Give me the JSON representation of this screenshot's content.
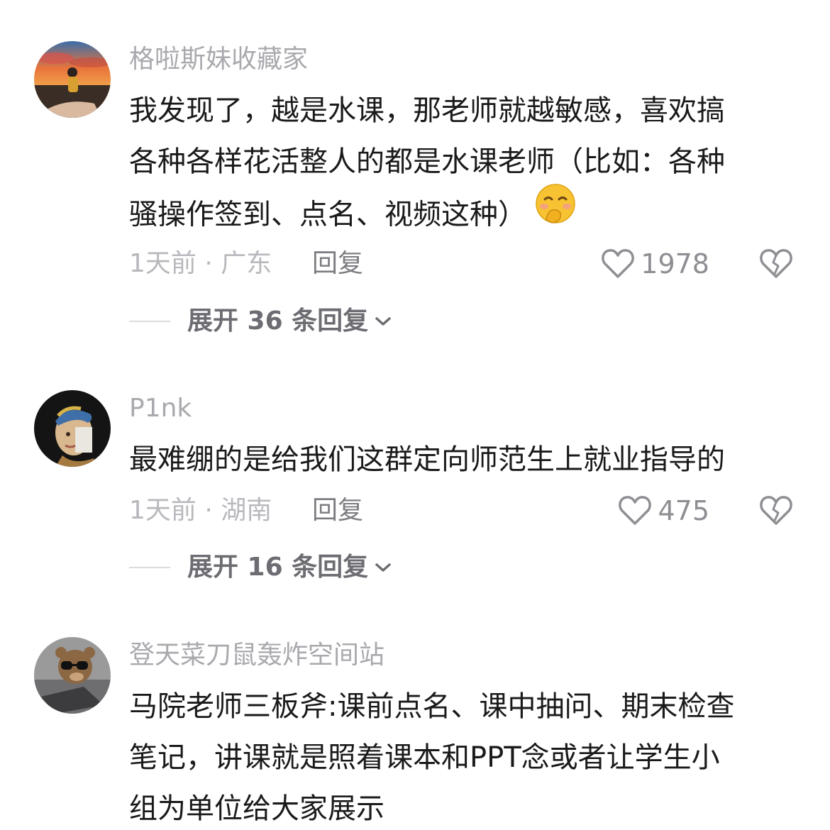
{
  "comments": [
    {
      "username": "格啦斯妹收藏家",
      "lines": [
        "我发现了，越是水课，那老师就越敏感，喜欢搞",
        "各种各样花活整人的都是水课老师（比如：各种",
        "骚操作签到、点名、视频这种）"
      ],
      "emoji": "shy-smile-emoji",
      "time": "1天前",
      "location": "广东",
      "meta": "1天前 · 广东",
      "reply_label": "回复",
      "likes": "1978",
      "expand_label": "展开 36 条回复"
    },
    {
      "username": "P1nk",
      "lines": [
        "最难绷的是给我们这群定向师范生上就业指导的"
      ],
      "time": "1天前",
      "location": "湖南",
      "meta": "1天前 · 湖南",
      "reply_label": "回复",
      "likes": "475",
      "expand_label": "展开 16 条回复"
    },
    {
      "username": "登天菜刀鼠轰炸空间站",
      "lines": [
        "马院老师三板斧:课前点名、课中抽问、期末检查",
        "笔记，讲课就是照着课本和PPT念或者让学生小",
        "组为单位给大家展示"
      ]
    }
  ],
  "colors": {
    "username": "#a9a9ae",
    "body": "#1a1a1a",
    "meta": "#b8b8bd",
    "reply": "#7c7c82",
    "expand": "#6c6c72"
  },
  "icons": {
    "like": "heart-outline-icon",
    "dislike": "broken-heart-icon",
    "expand": "chevron-down-icon"
  }
}
